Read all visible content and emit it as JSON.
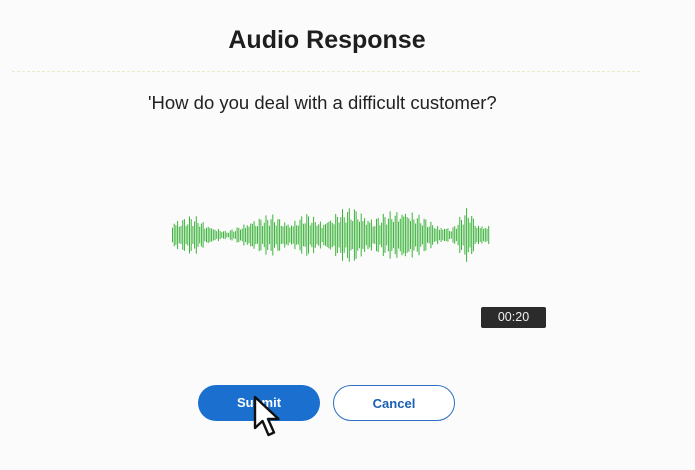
{
  "dialog": {
    "title": "Audio Response",
    "question": "'How do you deal with a difficult customer?"
  },
  "recording": {
    "elapsed": "00:20",
    "waveform_color": "#3cb43c"
  },
  "actions": {
    "submit_label": "Submit",
    "cancel_label": "Cancel"
  },
  "colors": {
    "primary": "#1a6fcf",
    "timer_bg": "#2b2b2b"
  }
}
